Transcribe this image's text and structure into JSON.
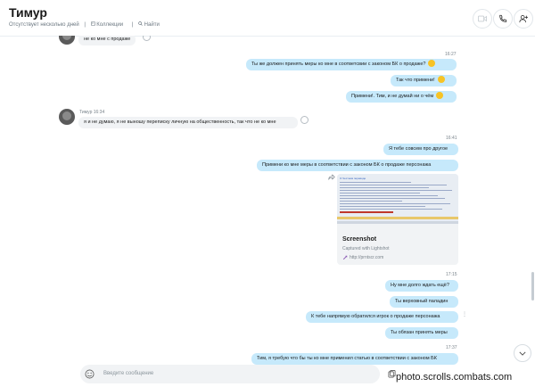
{
  "header": {
    "title": "Тимур",
    "status": "Отсутствует несколько дней",
    "separator": "|",
    "collections": "Коллекции",
    "find": "Найти"
  },
  "messages": {
    "m0": "не ко мне с продаже",
    "t1": "16:27",
    "m1": "Ты же должен принять меры ко мне в соответсвии с законом БК о продаже?",
    "m2": "Так что  примени!",
    "m3": "Примени!. Тим, и не думай ни о чём",
    "t4": "Тимур 16:34",
    "m4": "я и не думаю, я не выношу переписку личную на общественность, так что не ко мне",
    "t5": "16:41",
    "m5": "Я тебе совсем про другое",
    "m6": "Примени ко мне меры в соответствии   с законом БК о продаже персонажа",
    "t7": "17:15",
    "m7": "Ну мне долго ждать ещё?",
    "m8": "Ты верховный паладин",
    "m9": "К тебе напрямую обратился игрок о продаже персонажа",
    "m10": "Ты обязан принять меры",
    "t11": "17:37",
    "m11": "Тим, я требую что бы ты ко мне применил статью в соответствии с законом БК"
  },
  "link_card": {
    "title": "Screenshot",
    "subtitle": "Captured with Lightshot",
    "url": "http://prntscr.com",
    "preview_heading": "О Честном переводе"
  },
  "composer": {
    "placeholder": "Введите сообщение"
  },
  "watermark": "photo.scrolls.combats.com",
  "colors": {
    "outgoing_bubble": "#c6e9fb",
    "incoming_bubble": "#f1f3f5",
    "emoji": "#f7c325",
    "accent": "#00aff0"
  },
  "icons": [
    "video-call-icon",
    "audio-call-icon",
    "add-person-icon",
    "collections-icon",
    "search-icon",
    "emoji-icon",
    "attach-icon",
    "image-icon",
    "mic-icon",
    "chevron-down-icon",
    "link-icon",
    "share-icon",
    "reaction-icon"
  ]
}
